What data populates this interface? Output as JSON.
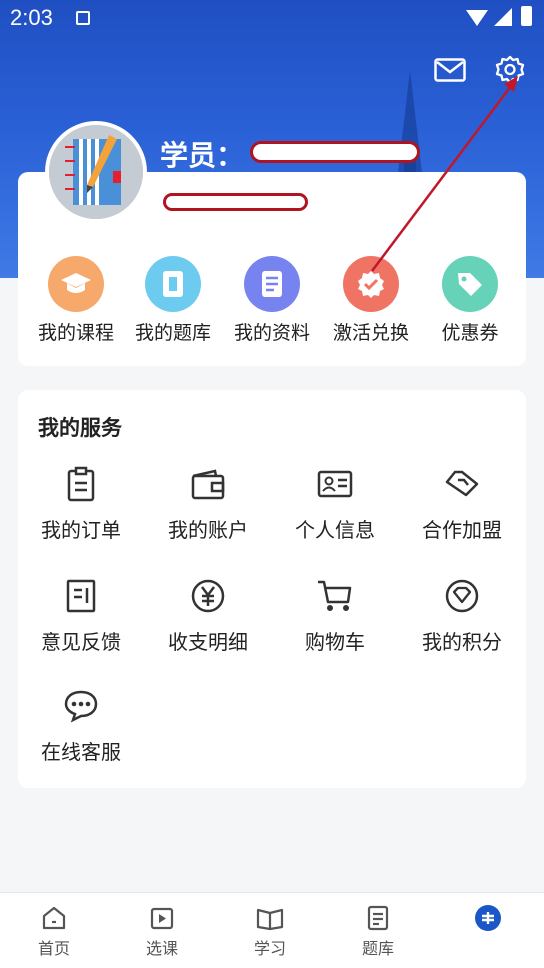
{
  "status_bar": {
    "time": "2:03"
  },
  "header": {
    "nickname_label": "学员：",
    "icons": [
      "mail-icon",
      "gear-icon"
    ]
  },
  "quick_actions": [
    {
      "label": "我的课程",
      "icon": "graduation-cap-icon",
      "color": "#f5a35c"
    },
    {
      "label": "我的题库",
      "icon": "bookmark-icon",
      "color": "#5cc4ee"
    },
    {
      "label": "我的资料",
      "icon": "document-icon",
      "color": "#6d7cf0"
    },
    {
      "label": "激活兑换",
      "icon": "verified-badge-icon",
      "color": "#f07060"
    },
    {
      "label": "优惠券",
      "icon": "tag-icon",
      "color": "#5fd0b5"
    }
  ],
  "services": {
    "title": "我的服务",
    "items": [
      {
        "label": "我的订单",
        "icon": "clipboard-icon"
      },
      {
        "label": "我的账户",
        "icon": "wallet-icon"
      },
      {
        "label": "个人信息",
        "icon": "id-card-icon"
      },
      {
        "label": "合作加盟",
        "icon": "handshake-icon"
      },
      {
        "label": "意见反馈",
        "icon": "feedback-icon"
      },
      {
        "label": "收支明细",
        "icon": "yuan-icon"
      },
      {
        "label": "购物车",
        "icon": "cart-icon"
      },
      {
        "label": "我的积分",
        "icon": "points-icon"
      },
      {
        "label": "在线客服",
        "icon": "chat-icon"
      }
    ]
  },
  "bottom_nav": [
    {
      "label": "首页",
      "icon": "home-icon"
    },
    {
      "label": "选课",
      "icon": "course-select-icon"
    },
    {
      "label": "学习",
      "icon": "book-icon"
    },
    {
      "label": "题库",
      "icon": "question-bank-icon"
    },
    {
      "label": "",
      "icon": "profile-active-icon",
      "active_color": "#1a56c8"
    }
  ]
}
